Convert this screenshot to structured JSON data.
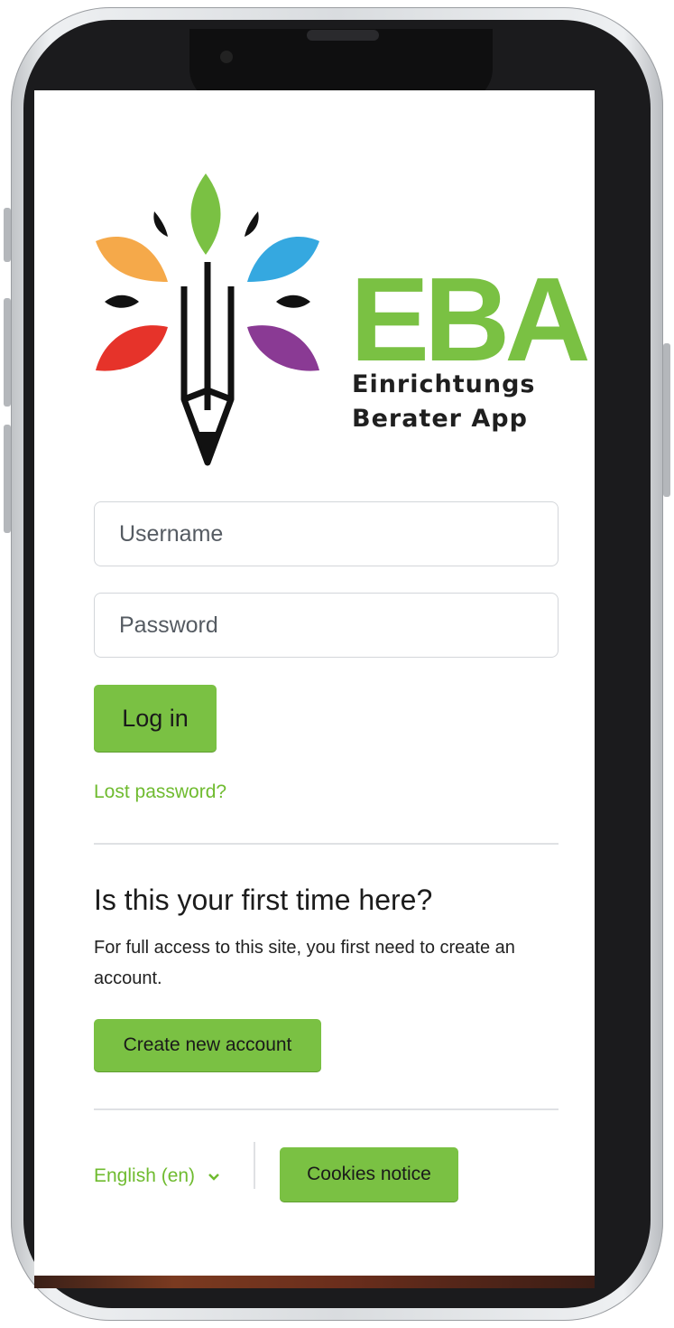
{
  "brand": {
    "acronym": "EBA",
    "line1": "Einrichtungs",
    "line2": "Berater App"
  },
  "login": {
    "username_placeholder": "Username",
    "password_placeholder": "Password",
    "login_label": "Log in",
    "lost_password": "Lost password?"
  },
  "signup": {
    "heading": "Is this your first time here?",
    "text": "For full access to this site, you first need to create an account.",
    "create_label": "Create new account"
  },
  "footer": {
    "language": "English (en)",
    "cookies_label": "Cookies notice"
  },
  "colors": {
    "accent": "#7ac143",
    "leaf_green": "#7ac143",
    "leaf_orange": "#f5a94a",
    "leaf_blue": "#35a8e0",
    "leaf_red": "#e6332a",
    "leaf_purple": "#8a3a94"
  }
}
